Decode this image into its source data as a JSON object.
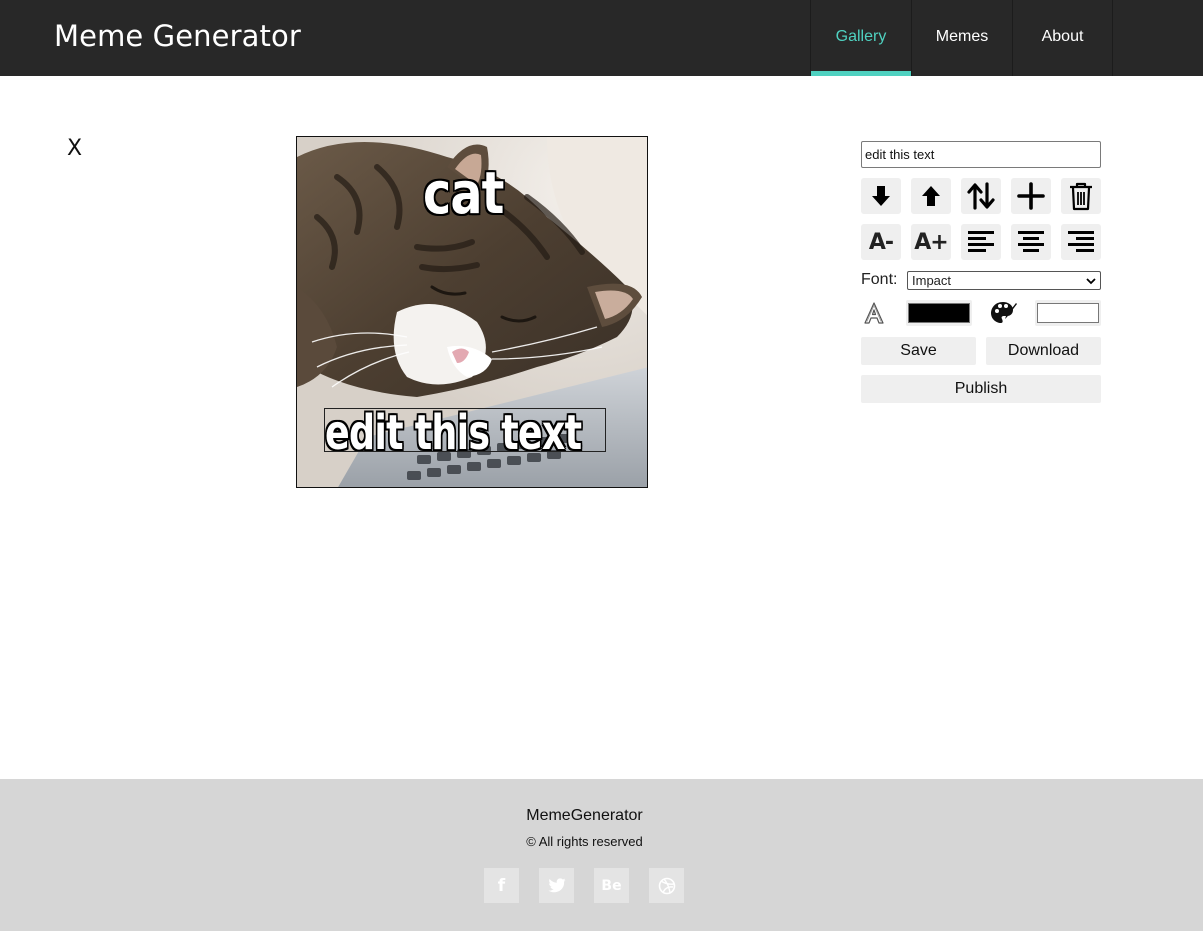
{
  "header": {
    "brand": "Meme Generator",
    "nav": [
      {
        "label": "Gallery",
        "active": true
      },
      {
        "label": "Memes",
        "active": false
      },
      {
        "label": "About",
        "active": false
      }
    ],
    "accent_color": "#4fd1c0"
  },
  "editor": {
    "close_label": "X",
    "canvas": {
      "image": "sleeping-cat-on-keyboard",
      "lines": [
        "cat",
        "edit this text"
      ]
    },
    "controls": {
      "text_value": "edit this text",
      "row1_icons": [
        "arrow-down-icon",
        "arrow-up-icon",
        "swap-vertical-icon",
        "plus-icon",
        "trash-icon"
      ],
      "row2_icons": [
        "decrease-font-icon",
        "increase-font-icon",
        "align-left-icon",
        "align-center-icon",
        "align-right-icon"
      ],
      "decrease_font_label": "A-",
      "increase_font_label": "A+",
      "font_label": "Font:",
      "font_selected": "Impact",
      "stroke_color": "#000000",
      "fill_color": "#ffffff",
      "save_label": "Save",
      "download_label": "Download",
      "publish_label": "Publish"
    }
  },
  "footer": {
    "title": "MemeGenerator",
    "copyright": "© All rights reserved",
    "social": [
      {
        "icon": "facebook-icon",
        "label": "f"
      },
      {
        "icon": "twitter-icon",
        "label": ""
      },
      {
        "icon": "behance-icon",
        "label": "Be"
      },
      {
        "icon": "dribbble-icon",
        "label": ""
      }
    ]
  }
}
